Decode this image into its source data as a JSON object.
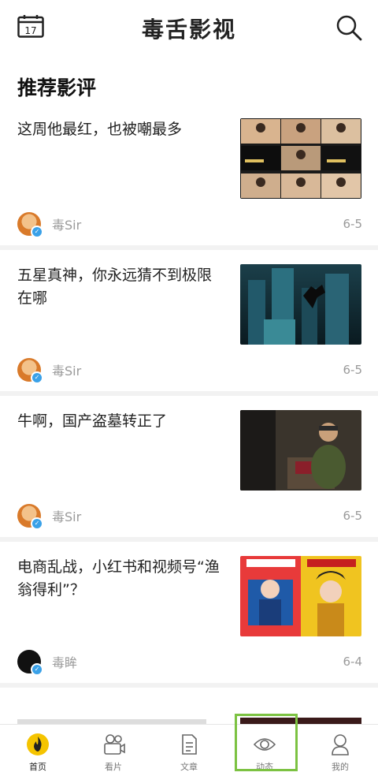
{
  "header": {
    "calendar_day": "17",
    "title": "毒舌影视"
  },
  "section_title": "推荐影评",
  "articles": [
    {
      "title": "这周他最红，也被嘲最多",
      "author": "毒Sir",
      "date": "6-5"
    },
    {
      "title": "五星真神，你永远猜不到极限在哪",
      "author": "毒Sir",
      "date": "6-5"
    },
    {
      "title": "牛啊，国产盗墓转正了",
      "author": "毒Sir",
      "date": "6-5"
    },
    {
      "title": "电商乱战，小红书和视频号“渔翁得利”？",
      "author": "毒眸",
      "date": "6-4"
    }
  ],
  "tabs": [
    {
      "label": "首页",
      "icon": "home-flame-icon"
    },
    {
      "label": "看片",
      "icon": "camera-icon"
    },
    {
      "label": "文章",
      "icon": "document-icon"
    },
    {
      "label": "动态",
      "icon": "eye-icon"
    },
    {
      "label": "我的",
      "icon": "person-icon"
    }
  ],
  "colors": {
    "accent_yellow": "#f5c400",
    "highlight_green": "#7cc242",
    "verified_blue": "#3aa1e8"
  }
}
